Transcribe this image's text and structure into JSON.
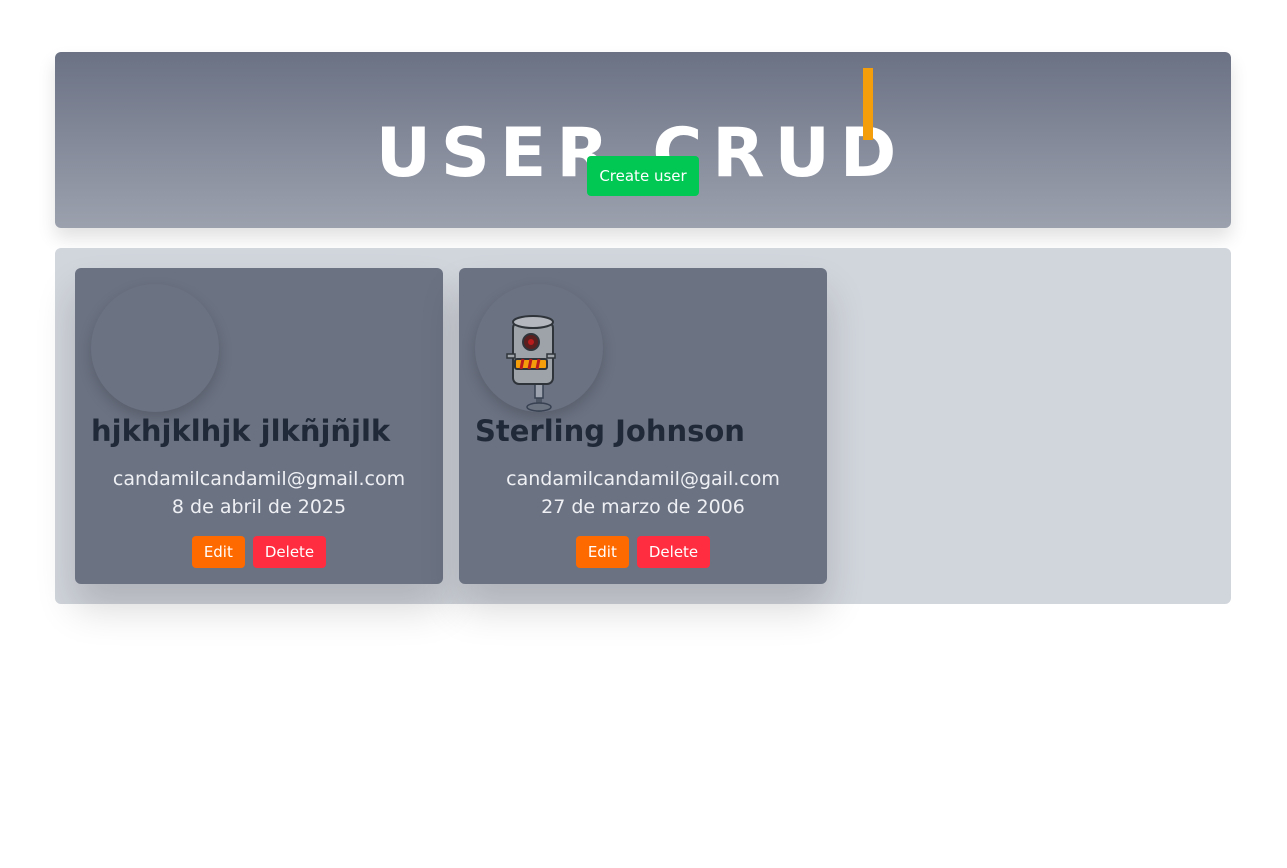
{
  "header": {
    "title": "USER CRUD",
    "create_button_label": "Create user"
  },
  "users": [
    {
      "name": "hjkhjklhjk jlkñjñjlk",
      "email": "candamilcandamil@gmail.com",
      "date": "8 de abril de 2025",
      "edit_label": "Edit",
      "delete_label": "Delete",
      "avatar": "empty-avatar"
    },
    {
      "name": "Sterling Johnson",
      "email": "candamilcandamil@gail.com",
      "date": "27 de marzo de 2006",
      "edit_label": "Edit",
      "delete_label": "Delete",
      "avatar": "robot-avatar"
    }
  ],
  "colors": {
    "header_gradient_top": "#6b7284",
    "header_gradient_bottom": "#9ca1ae",
    "create_button": "#00c853",
    "edit_button": "#ff6a00",
    "delete_button": "#ff2d3f",
    "cursor": "#f59e0b",
    "card_bg": "#6b7282",
    "list_bg": "#d1d5dc"
  }
}
